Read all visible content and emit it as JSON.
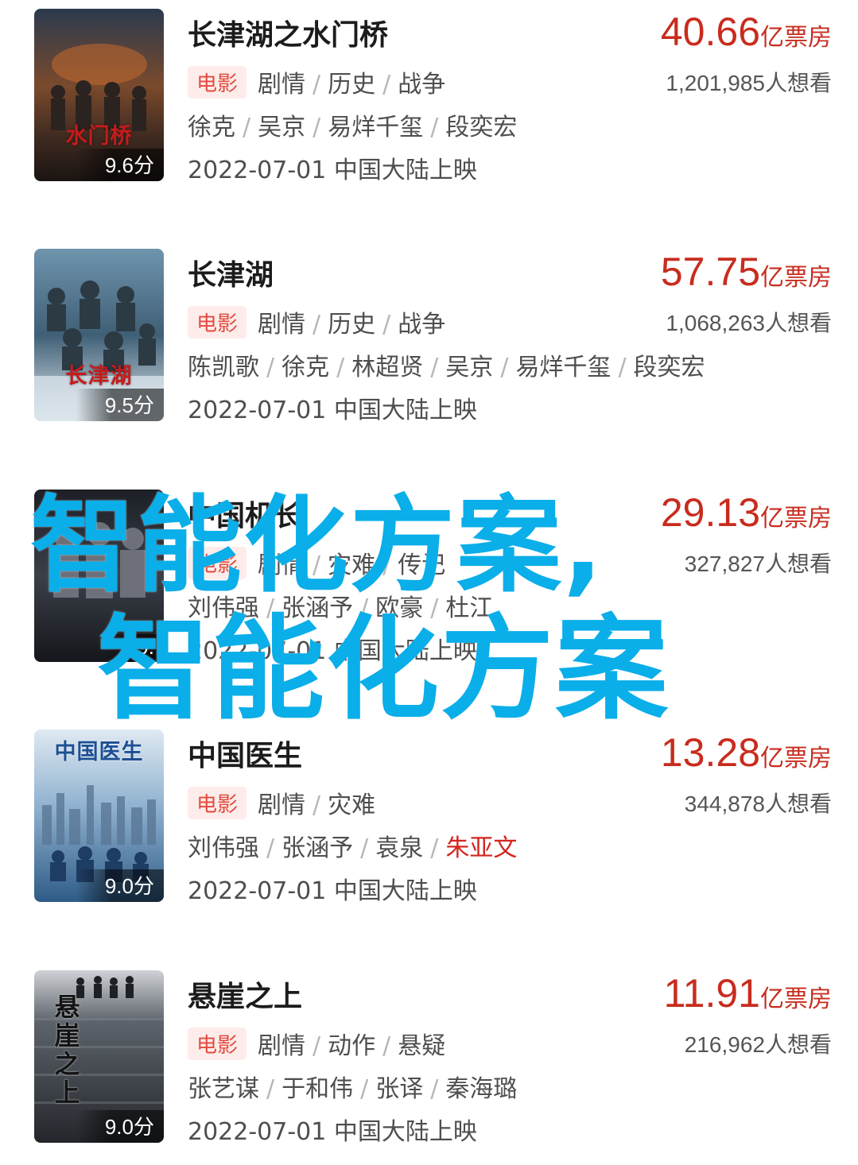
{
  "movies": [
    {
      "title": "长津湖之水门桥",
      "poster_title": "水门桥",
      "score": "9.6分",
      "box_office": "40.66",
      "box_office_unit": "亿票房",
      "tag": "电影",
      "genres": [
        "剧情",
        "历史",
        "战争"
      ],
      "wants": "1,201,985人想看",
      "cast": [
        "徐克",
        "吴京",
        "易烊千玺",
        "段奕宏"
      ],
      "release": "2022-07-01 中国大陆上映"
    },
    {
      "title": "长津湖",
      "poster_title": "长津湖",
      "score": "9.5分",
      "box_office": "57.75",
      "box_office_unit": "亿票房",
      "tag": "电影",
      "genres": [
        "剧情",
        "历史",
        "战争"
      ],
      "wants": "1,068,263人想看",
      "cast": [
        "陈凯歌",
        "徐克",
        "林超贤",
        "吴京",
        "易烊千玺",
        "段奕宏"
      ],
      "release": "2022-07-01 中国大陆上映"
    },
    {
      "title": "中国机长",
      "score": "9.",
      "box_office": "29.13",
      "box_office_unit": "亿票房",
      "tag": "电影",
      "genres": [
        "剧情",
        "灾难",
        "传记"
      ],
      "wants": "327,827人想看",
      "cast": [
        "刘伟强",
        "张涵予",
        "欧豪",
        "杜江"
      ],
      "release": "2022-07-01 中国大陆上映"
    },
    {
      "title": "中国医生",
      "poster_title": "中国医生",
      "score": "9.0分",
      "box_office": "13.28",
      "box_office_unit": "亿票房",
      "tag": "电影",
      "genres": [
        "剧情",
        "灾难"
      ],
      "wants": "344,878人想看",
      "cast": [
        "刘伟强",
        "张涵予",
        "袁泉"
      ],
      "cast_highlight": "朱亚文",
      "release": "2022-07-01 中国大陆上映"
    },
    {
      "title": "悬崖之上",
      "poster_title": "悬崖之上",
      "score": "9.0分",
      "box_office": "11.91",
      "box_office_unit": "亿票房",
      "tag": "电影",
      "genres": [
        "剧情",
        "动作",
        "悬疑"
      ],
      "wants": "216,962人想看",
      "cast": [
        "张艺谋",
        "于和伟",
        "张译",
        "秦海璐"
      ],
      "release": "2022-07-01 中国大陆上映"
    }
  ],
  "watermark": {
    "line1": "智能化方案,",
    "line2": "智能化方案"
  },
  "colors": {
    "accent_red": "#c82c1e",
    "tag_bg": "#fdecea",
    "watermark_blue": "#0aaee9"
  }
}
